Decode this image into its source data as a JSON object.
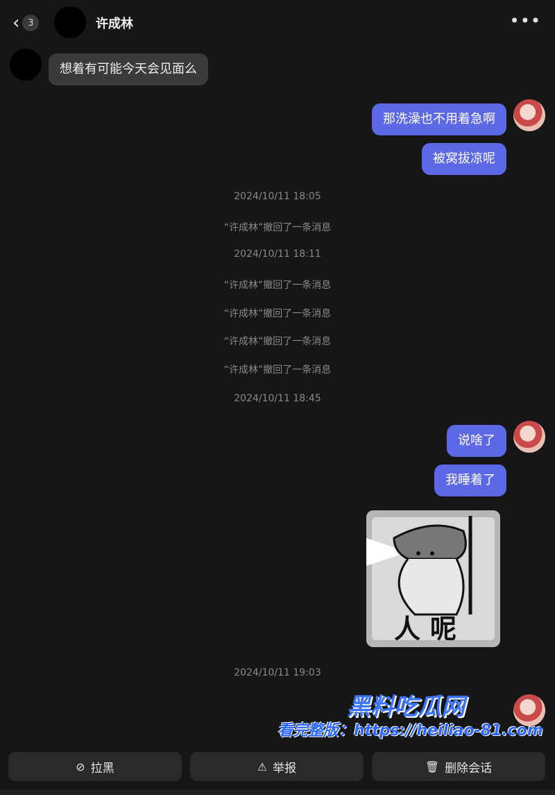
{
  "header": {
    "back_count": "3",
    "title": "许成林",
    "more_label": "•••"
  },
  "messages": {
    "m1": "想着有可能今天会见面么",
    "m2": "那洗澡也不用着急啊",
    "m3": "被窝拔凉呢",
    "m4": "说啥了",
    "m5": "我睡着了"
  },
  "system": {
    "t1": "2024/10/11 18:05",
    "r1": "“许成林”撤回了一条消息",
    "t2": "2024/10/11 18:11",
    "r2": "“许成林”撤回了一条消息",
    "r3": "“许成林”撤回了一条消息",
    "r4": "“许成林”撤回了一条消息",
    "r5": "“许成林”撤回了一条消息",
    "t3": "2024/10/11 18:45",
    "t4": "2024/10/11 19:03"
  },
  "sticker": {
    "text": "人呢"
  },
  "watermark": {
    "title": "黑料吃瓜网",
    "url_line": "看完整版：https://heiliao-81.com"
  },
  "actions": {
    "block": "拉黑",
    "report": "举报",
    "delete": "删除会话"
  },
  "icons": {
    "back": "chevron-left-icon",
    "block": "ban-icon",
    "report": "warning-icon",
    "delete": "trash-icon"
  }
}
